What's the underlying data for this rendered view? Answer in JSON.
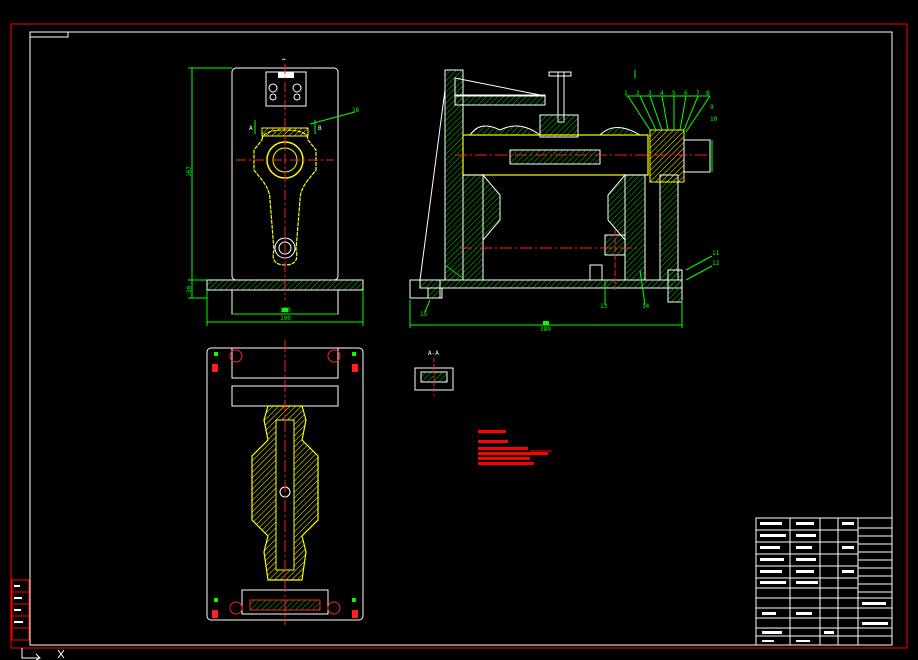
{
  "colors": {
    "background": "#000000",
    "frame": "#ff0000",
    "outline": "#ffffff",
    "dimension": "#00ff00",
    "centerline": "#ff2020",
    "workpiece": "#ffff00",
    "hatch": "#00cc00",
    "notes": "#ff0000"
  },
  "icons": [
    "ucs-axis-icon"
  ],
  "dimensions": {
    "left_height": "167",
    "left_base": "30",
    "left_width": "150",
    "left_overall": "190",
    "right_overall": "380",
    "top_arrow": "↔"
  },
  "callouts": {
    "section_label": "A-A",
    "callout_a": "A",
    "callout_b": "B",
    "balloons": [
      "1",
      "2",
      "3",
      "4",
      "5",
      "6",
      "7",
      "8",
      "9",
      "10",
      "11",
      "12",
      "13",
      "14",
      "15",
      "16"
    ]
  }
}
